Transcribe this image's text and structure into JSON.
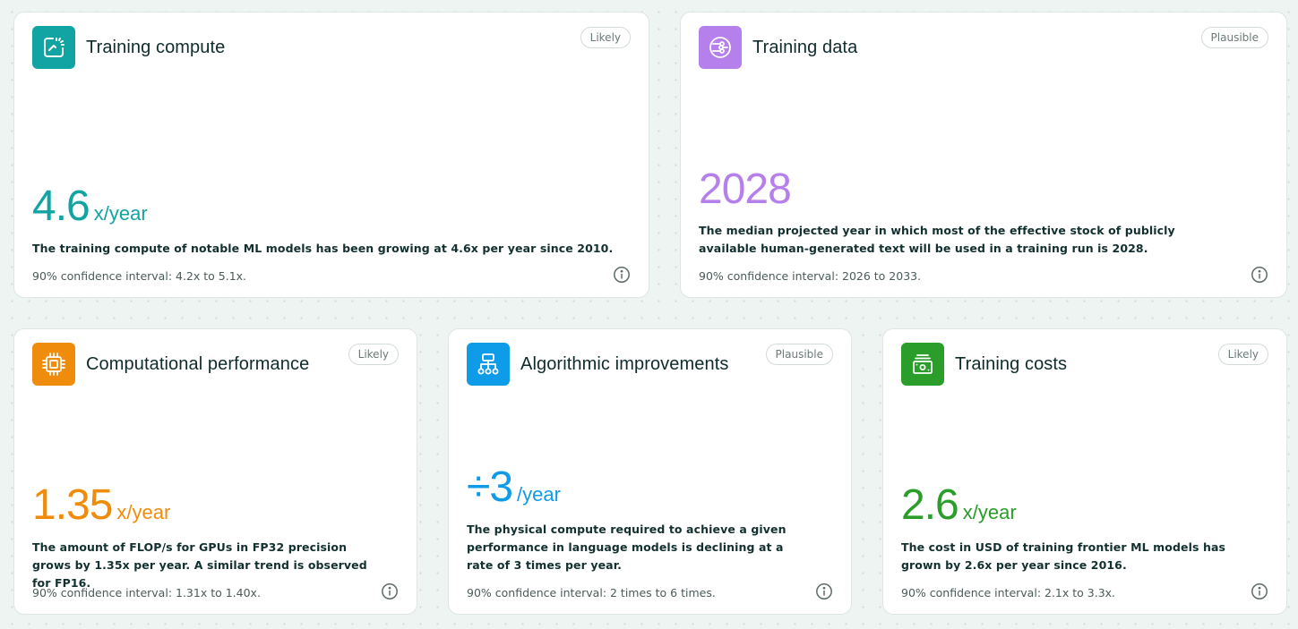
{
  "cards": {
    "training_compute": {
      "title": "Training compute",
      "badge": "Likely",
      "value": "4.6",
      "unit": "x/year",
      "description": "The training compute of notable ML models has been growing at 4.6x per year since 2010.",
      "confidence": "90% confidence interval: 4.2x to 5.1x.",
      "icon": "compute-chart-icon",
      "color": "#12a3a3"
    },
    "training_data": {
      "title": "Training data",
      "badge": "Plausible",
      "value": "2028",
      "unit": "",
      "description": "The median projected year in which most of the effective stock of publicly available human-generated text will be used in a training run is 2028.",
      "confidence": "90% confidence interval: 2026 to 2033.",
      "icon": "data-nodes-icon",
      "color": "#b57fec"
    },
    "computational_performance": {
      "title": "Computational performance",
      "badge": "Likely",
      "value": "1.35",
      "unit": "x/year",
      "description": "The amount of FLOP/s for GPUs in FP32 precision grows by 1.35x per year. A similar trend is observed for FP16.",
      "confidence": "90% confidence interval: 1.31x to 1.40x.",
      "icon": "chip-icon",
      "color": "#f08c0c"
    },
    "algorithmic_improvements": {
      "title": "Algorithmic improvements",
      "badge": "Plausible",
      "value": "÷3",
      "unit": "/year",
      "description": "The physical compute required to achieve a given performance in language models is declining at a rate of 3 times per year.",
      "confidence": "90% confidence interval: 2 times to 6 times.",
      "icon": "hierarchy-icon",
      "color": "#0e9be8"
    },
    "training_costs": {
      "title": "Training costs",
      "badge": "Likely",
      "value": "2.6",
      "unit": "x/year",
      "description": "The cost in USD of training frontier ML models has grown by 2.6x per year since 2016.",
      "confidence": "90% confidence interval: 2.1x to 3.3x.",
      "icon": "money-stack-icon",
      "color": "#2a9d2a"
    }
  }
}
